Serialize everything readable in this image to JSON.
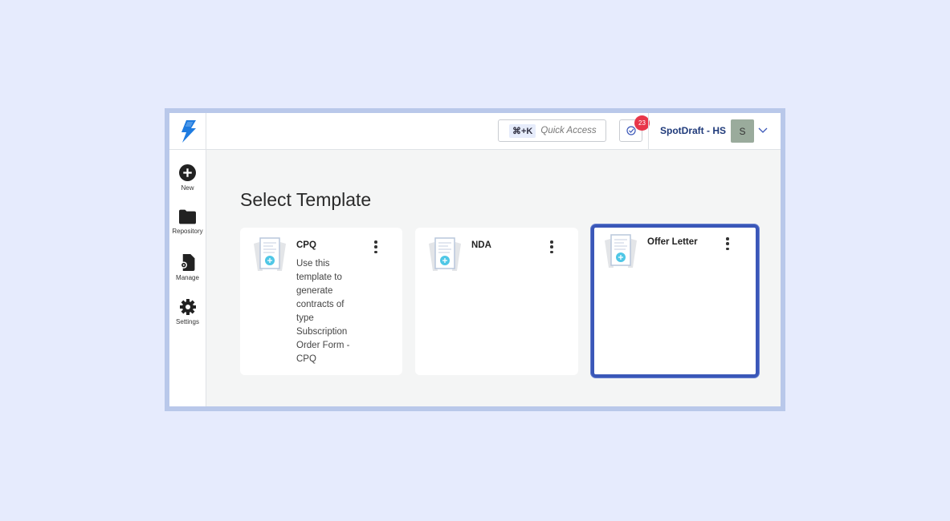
{
  "header": {
    "shortcut": "⌘+K",
    "quick_access_placeholder": "Quick Access",
    "task_count": "23",
    "org_name": "SpotDraft - HS",
    "avatar_initial": "S"
  },
  "sidebar": {
    "items": [
      {
        "label": "New"
      },
      {
        "label": "Repository"
      },
      {
        "label": "Manage"
      },
      {
        "label": "Settings"
      }
    ]
  },
  "main": {
    "title": "Select Template",
    "templates": [
      {
        "title": "CPQ",
        "description": "Use this template to generate contracts of type Subscription Order Form - CPQ",
        "selected": false
      },
      {
        "title": "NDA",
        "description": "",
        "selected": false
      },
      {
        "title": "Offer Letter",
        "description": "",
        "selected": true
      }
    ]
  },
  "colors": {
    "accent": "#3a57b8",
    "badge": "#e8364a",
    "brand": "#1e7be0"
  }
}
